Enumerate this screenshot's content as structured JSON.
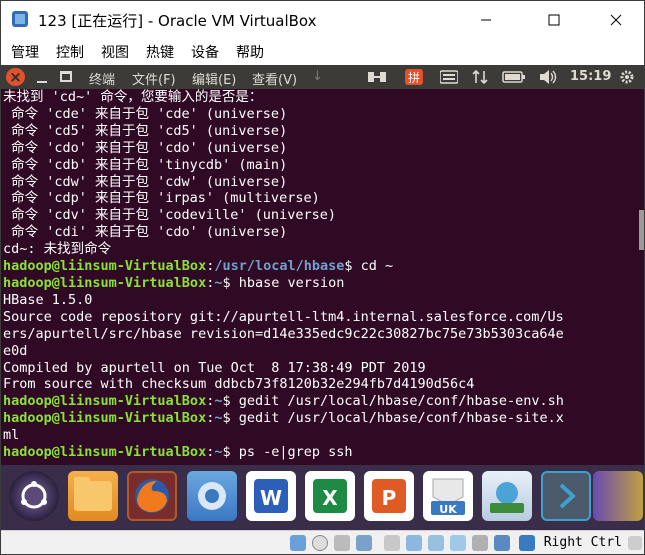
{
  "window": {
    "title": "123 [正在运行] - Oracle VM VirtualBox"
  },
  "menubar": {
    "items": [
      "管理",
      "控制",
      "视图",
      "热键",
      "设备",
      "帮助"
    ]
  },
  "panel": {
    "menus": [
      "终端",
      "文件(F)",
      "编辑(E)",
      "查看(V)"
    ],
    "clock": "15:19"
  },
  "terminal": {
    "lines": [
      "未找到 'cd~' 命令，您要输入的是否是：",
      " 命令 'cde' 来自于包 'cde' (universe)",
      " 命令 'cd5' 来自于包 'cd5' (universe)",
      " 命令 'cdo' 来自于包 'cdo' (universe)",
      " 命令 'cdb' 来自于包 'tinycdb' (main)",
      " 命令 'cdw' 来自于包 'cdw' (universe)",
      " 命令 'cdp' 来自于包 'irpas' (multiverse)",
      " 命令 'cdv' 来自于包 'codeville' (universe)",
      " 命令 'cdi' 来自于包 'cdo' (universe)",
      "cd~: 未找到命令"
    ],
    "prompt_user": "hadoop@liinsum-VirtualBox",
    "prompts": [
      {
        "path": "/usr/local/hbase",
        "cmd": " cd ~"
      },
      {
        "path": "~",
        "cmd": " hbase version"
      }
    ],
    "output": [
      "HBase 1.5.0",
      "Source code repository git://apurtell-ltm4.internal.salesforce.com/Us",
      "ers/apurtell/src/hbase revision=d14e335edc9c22c30827bc75e73b5303ca64e",
      "e0d",
      "Compiled by apurtell on Tue Oct  8 17:38:49 PDT 2019",
      "From source with checksum ddbcb73f8120b32e294fb7d4190d56c4"
    ],
    "prompts2": [
      {
        "path": "~",
        "cmd": " gedit /usr/local/hbase/conf/hbase-env.sh"
      },
      {
        "path": "~",
        "cmd": " gedit /usr/local/hbase/conf/hbase-site.x"
      }
    ],
    "wrap": "ml",
    "last_prompt": {
      "path": "~",
      "cmd": " ps -e|grep ssh"
    },
    "colors": {
      "bg": "#300a24",
      "user": "#8ae234",
      "path": "#729fcf"
    }
  },
  "dock": {
    "apps": [
      "ubuntu-icon",
      "files-icon",
      "firefox-icon",
      "chromium-icon",
      "word-icon",
      "excel-icon",
      "powerpoint-icon",
      "ukui-icon",
      "software-icon",
      "arrow-icon"
    ],
    "badge": "UK"
  },
  "statusbar": {
    "host_key": "Right Ctrl"
  }
}
